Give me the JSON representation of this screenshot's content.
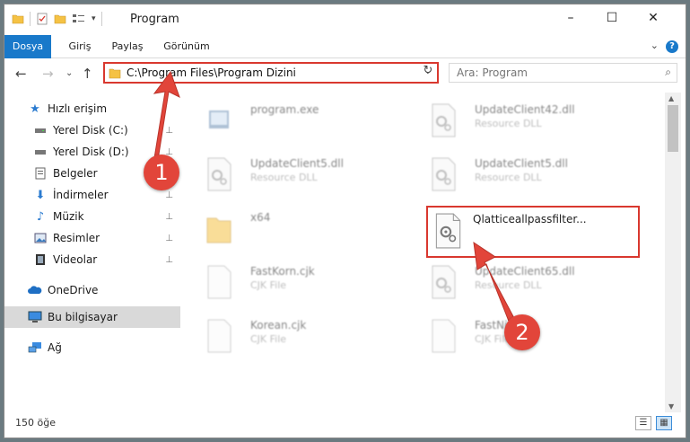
{
  "window": {
    "title": "Program",
    "minimize": "–",
    "maximize": "☐",
    "close": "✕"
  },
  "ribbon": {
    "tabs": [
      {
        "label": "Dosya",
        "active": true
      },
      {
        "label": "Giriş"
      },
      {
        "label": "Paylaş"
      },
      {
        "label": "Görünüm"
      }
    ],
    "help": "?",
    "expand": "⌄"
  },
  "nav": {
    "back": "←",
    "forward": "→",
    "recent": "⌄",
    "up": "↑",
    "address": "C:\\Program Files\\Program Dizini",
    "dropdown": "⌄",
    "refresh": "↻",
    "search_placeholder": "Ara: Program"
  },
  "sidebar": {
    "items": [
      {
        "label": "Hızlı erişim",
        "icon": "star-icon",
        "pinned": false
      },
      {
        "label": "Yerel Disk (C:)",
        "icon": "disk-icon",
        "pinned": true
      },
      {
        "label": "Yerel Disk (D:)",
        "icon": "disk-icon",
        "pinned": true
      },
      {
        "label": "Belgeler",
        "icon": "documents-icon",
        "pinned": true
      },
      {
        "label": "İndirmeler",
        "icon": "download-icon",
        "pinned": true
      },
      {
        "label": "Müzik",
        "icon": "music-icon",
        "pinned": true
      },
      {
        "label": "Resimler",
        "icon": "pictures-icon",
        "pinned": true
      },
      {
        "label": "Videolar",
        "icon": "videos-icon",
        "pinned": true
      },
      {
        "label": "OneDrive",
        "icon": "cloud-icon",
        "pinned": false
      },
      {
        "label": "Bu bilgisayar",
        "icon": "computer-icon",
        "pinned": false,
        "selected": true
      },
      {
        "label": "Ağ",
        "icon": "network-icon",
        "pinned": false
      }
    ],
    "pin_glyph": "📌"
  },
  "files": [
    {
      "name": "program.exe",
      "type": ""
    },
    {
      "name": "UpdateClient42.dll",
      "type": "Resource DLL"
    },
    {
      "name": "UpdateClient5.dll",
      "type": "Resource DLL"
    },
    {
      "name": "UpdateClient5.dll",
      "type": "Resource DLL"
    },
    {
      "name": "x64",
      "type": ""
    },
    {
      "name": "FastKorn.cjk",
      "type": "CJK File"
    },
    {
      "name": "UpdateClient65.dll",
      "type": "Resource DLL"
    },
    {
      "name": "Korean.cjk",
      "type": "CJK File"
    },
    {
      "name": "FastNi...",
      "type": "CJK File"
    }
  ],
  "highlighted_file": {
    "name": "Qlatticeallpassfilter..."
  },
  "status": {
    "count": "150 öğe",
    "details_view": "☰",
    "tiles_view": "▦"
  },
  "callouts": {
    "one": "1",
    "two": "2"
  },
  "colors": {
    "accent": "#1979ca",
    "highlight": "#d9382f",
    "badge": "#e2453a"
  }
}
